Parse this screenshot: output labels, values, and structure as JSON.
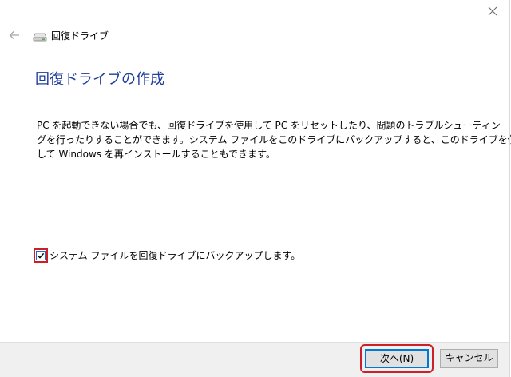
{
  "window": {
    "title": "回復ドライブ",
    "icons": {
      "back": "back-arrow-icon",
      "drive": "drive-icon",
      "close": "close-icon"
    }
  },
  "main": {
    "heading": "回復ドライブの作成",
    "description_lines": [
      "PC を起動できない場合でも、回復ドライブを使用して PC をリセットしたり、問題のトラブルシューティン",
      "グを行ったりすることができます。システム ファイルをこのドライブにバックアップすると、このドライブを使用",
      "して Windows を再インストールすることもできます。"
    ],
    "backup_option": {
      "label": "システム ファイルを回復ドライブにバックアップします。",
      "checked": true
    }
  },
  "footer": {
    "next_label": "次へ(N)",
    "cancel_label": "キャンセル"
  },
  "colors": {
    "heading": "#1f3d9c",
    "accent": "#0078d7",
    "highlight": "#cc1f2a",
    "footer_bg": "#f0f0f0"
  }
}
